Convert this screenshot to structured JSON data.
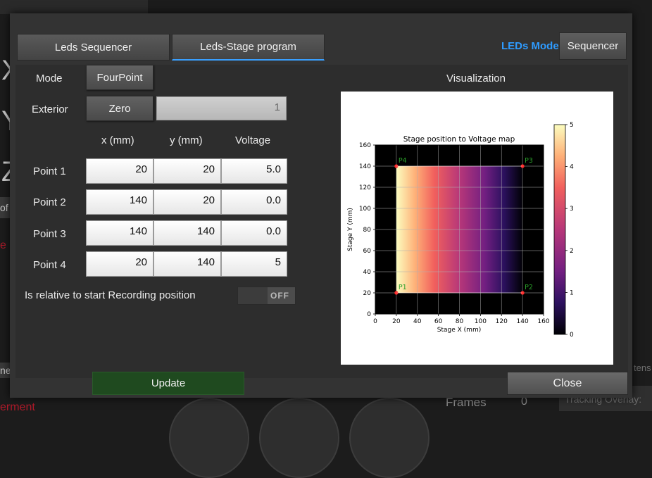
{
  "background": {
    "letters": [
      "X",
      "Y",
      "Z"
    ],
    "fragment_of": "of",
    "fragment_e": "e",
    "fragment_ne": "ne",
    "fragment_erment": "erment",
    "frames_label": "Frames",
    "frames_value": "0",
    "tracking_overlay": "Tracking Overlay:",
    "fragment_tens": "tens"
  },
  "tabs": [
    {
      "label": "Leds Sequencer",
      "active": false
    },
    {
      "label": "Leds-Stage program",
      "active": true
    }
  ],
  "leds_mode": {
    "label": "LEDs Mode",
    "value": "Sequencer"
  },
  "form": {
    "mode_label": "Mode",
    "mode_value": "FourPoint",
    "exterior_label": "Exterior",
    "exterior_value": "Zero",
    "exterior_field": "1",
    "col_x": "x (mm)",
    "col_y": "y (mm)",
    "col_v": "Voltage",
    "points": [
      {
        "label": "Point 1",
        "x": "20",
        "y": "20",
        "v": "5.0"
      },
      {
        "label": "Point 2",
        "x": "140",
        "y": "20",
        "v": "0.0"
      },
      {
        "label": "Point 3",
        "x": "140",
        "y": "140",
        "v": "0.0"
      },
      {
        "label": "Point 4",
        "x": "20",
        "y": "140",
        "v": "5"
      }
    ],
    "relative_label": "Is relative to start Recording position",
    "relative_toggle": "OFF"
  },
  "update_label": "Update",
  "close_label": "Close",
  "visualization": {
    "title": "Visualization",
    "chart_data": {
      "type": "heatmap",
      "title": "Stage position to Voltage map",
      "xlabel": "Stage X (mm)",
      "ylabel": "Stage Y (mm)",
      "xlim": [
        0,
        160
      ],
      "ylim": [
        0,
        160
      ],
      "xticks": [
        0,
        20,
        40,
        60,
        80,
        100,
        120,
        140,
        160
      ],
      "yticks": [
        0,
        20,
        40,
        60,
        80,
        100,
        120,
        140,
        160
      ],
      "grid": true,
      "region": {
        "x": [
          20,
          140
        ],
        "y": [
          20,
          140
        ]
      },
      "voltage_at_x": {
        "x": [
          20,
          140
        ],
        "v": [
          5,
          0
        ]
      },
      "points": [
        {
          "name": "P1",
          "x": 20,
          "y": 20
        },
        {
          "name": "P2",
          "x": 140,
          "y": 20
        },
        {
          "name": "P3",
          "x": 140,
          "y": 140
        },
        {
          "name": "P4",
          "x": 20,
          "y": 140
        }
      ],
      "colorbar": {
        "min": 0,
        "max": 5,
        "ticks": [
          0,
          1,
          2,
          3,
          4,
          5
        ],
        "colormap": "magma"
      },
      "background_color": "#000000",
      "point_color": "#ff2a2a",
      "point_label_color": "#2aa02a"
    }
  }
}
